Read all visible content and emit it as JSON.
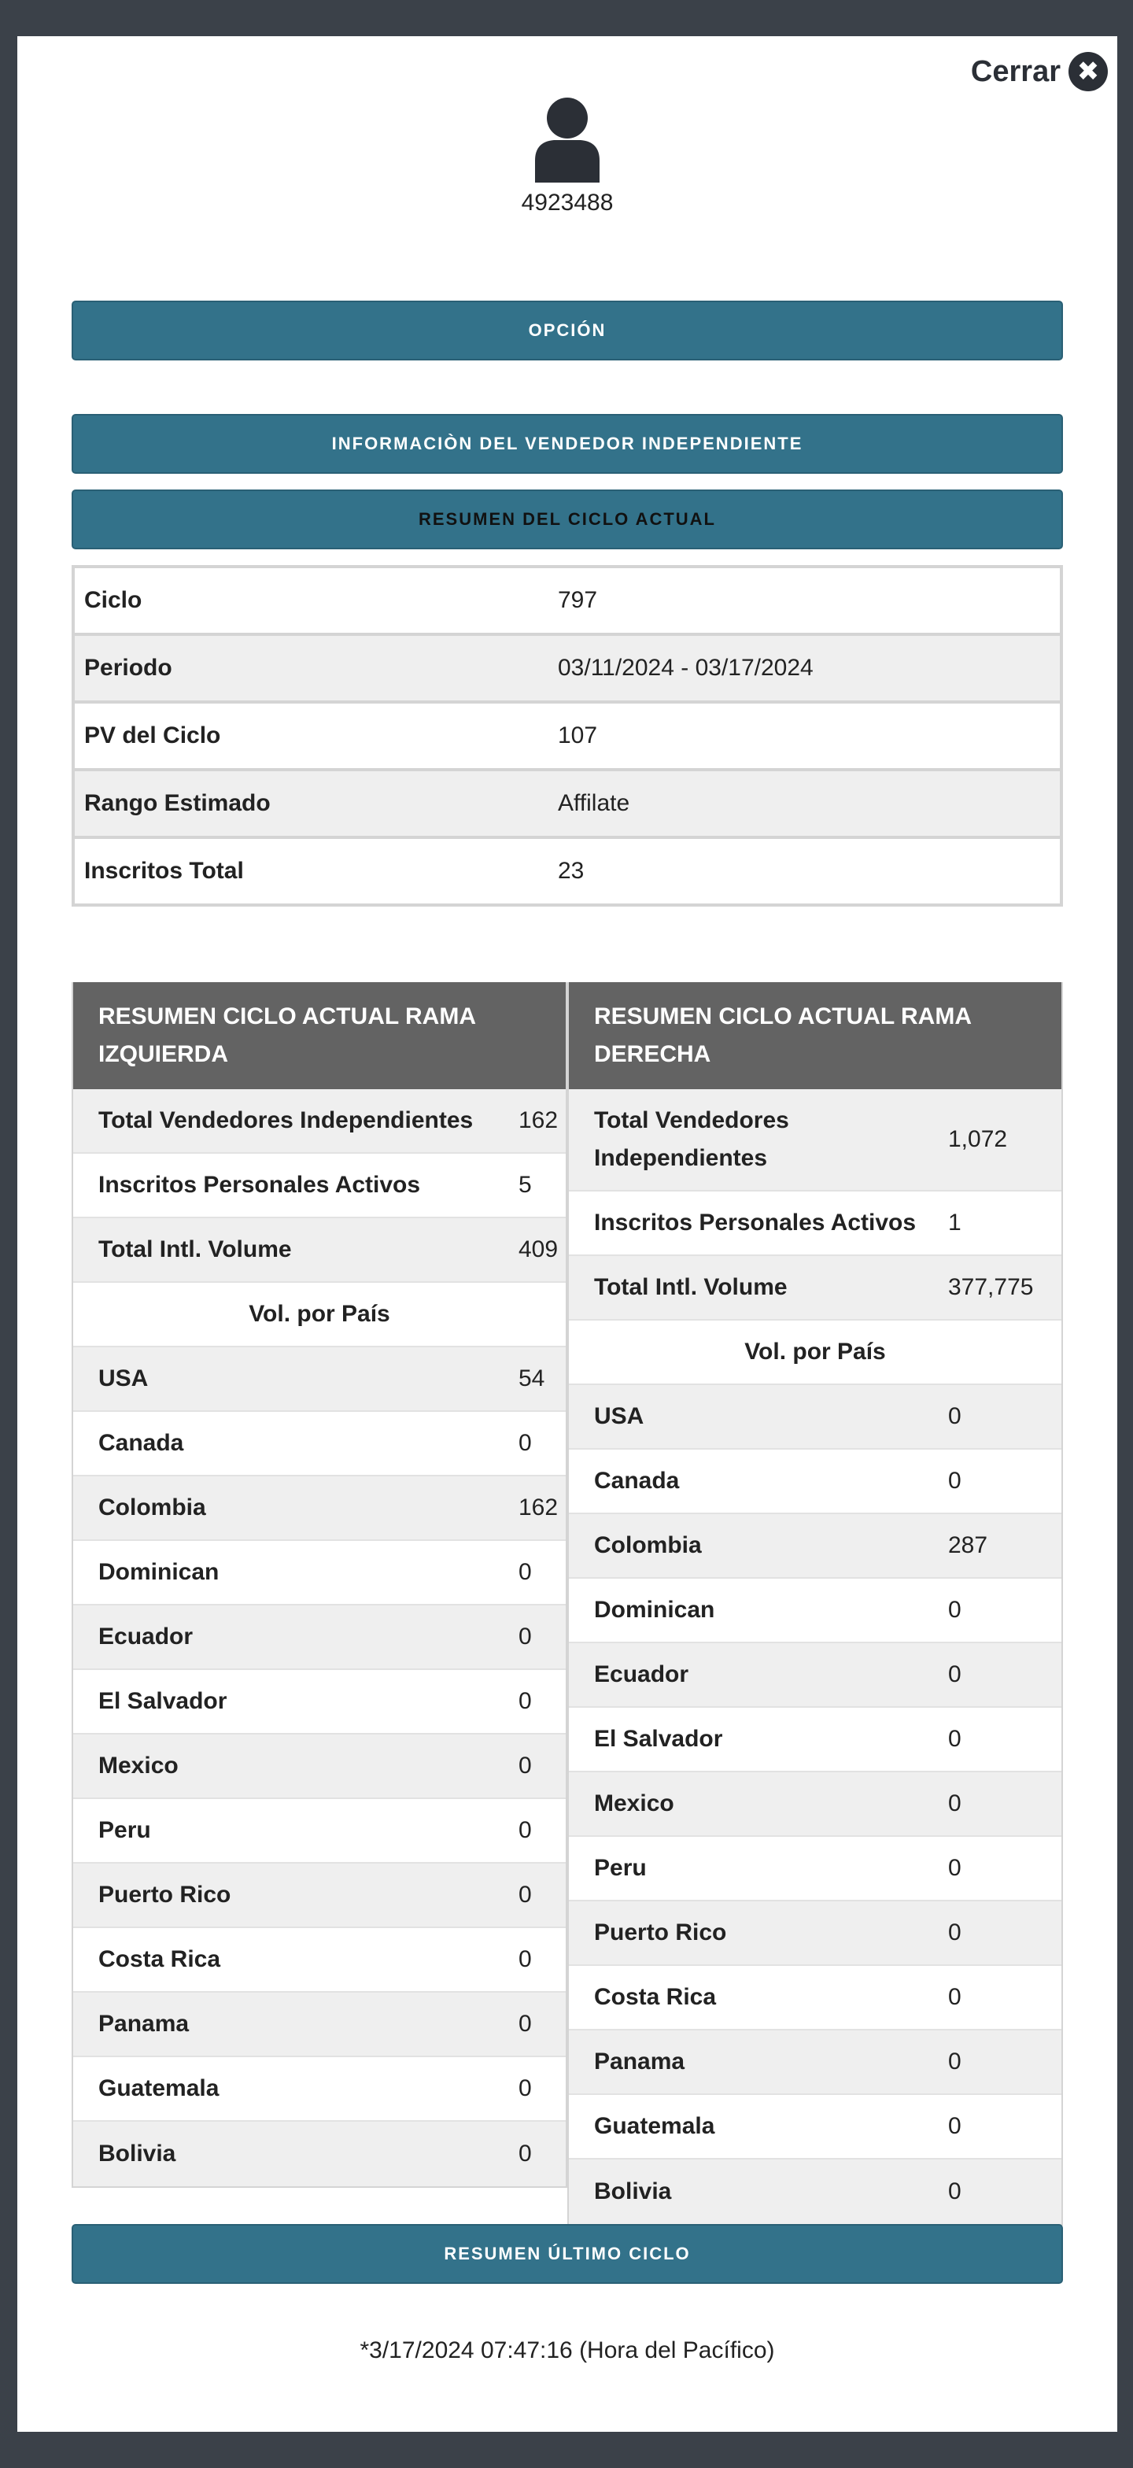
{
  "modal": {
    "close_label": "Cerrar",
    "close_icon": "x-circle-icon",
    "user_id": "4923488"
  },
  "buttons": {
    "option": "OPCIÓN",
    "vendor_info": "INFORMACIÒN DEL VENDEDOR INDEPENDIENTE",
    "current_cycle": "RESUMEN DEL CICLO ACTUAL",
    "last_cycle": "RESUMEN ÚLTIMO CICLO"
  },
  "summary": [
    {
      "label": "Ciclo",
      "value": "797"
    },
    {
      "label": "Periodo",
      "value": "03/11/2024 - 03/17/2024"
    },
    {
      "label": "PV del Ciclo",
      "value": "107"
    },
    {
      "label": "Rango Estimado",
      "value": "Affilate"
    },
    {
      "label": "Inscritos Total",
      "value": "23"
    }
  ],
  "left_branch": {
    "title": "RESUMEN CICLO ACTUAL RAMA IZQUIERDA",
    "stats": [
      {
        "label": "Total Vendedores Independientes",
        "value": "162"
      },
      {
        "label": "Inscritos Personales Activos",
        "value": "5"
      },
      {
        "label": "Total Intl. Volume",
        "value": "409"
      }
    ],
    "country_header": "Vol. por País",
    "countries": [
      {
        "label": "USA",
        "value": "54"
      },
      {
        "label": "Canada",
        "value": "0"
      },
      {
        "label": "Colombia",
        "value": "162"
      },
      {
        "label": "Dominican",
        "value": "0"
      },
      {
        "label": "Ecuador",
        "value": "0"
      },
      {
        "label": "El Salvador",
        "value": "0"
      },
      {
        "label": "Mexico",
        "value": "0"
      },
      {
        "label": "Peru",
        "value": "0"
      },
      {
        "label": "Puerto Rico",
        "value": "0"
      },
      {
        "label": "Costa Rica",
        "value": "0"
      },
      {
        "label": "Panama",
        "value": "0"
      },
      {
        "label": "Guatemala",
        "value": "0"
      },
      {
        "label": "Bolivia",
        "value": "0"
      }
    ]
  },
  "right_branch": {
    "title": "RESUMEN CICLO ACTUAL RAMA DERECHA",
    "stats": [
      {
        "label": "Total Vendedores Independientes",
        "value": "1,072"
      },
      {
        "label": "Inscritos Personales Activos",
        "value": "1"
      },
      {
        "label": "Total Intl. Volume",
        "value": "377,775"
      }
    ],
    "country_header": "Vol. por País",
    "countries": [
      {
        "label": "USA",
        "value": "0"
      },
      {
        "label": "Canada",
        "value": "0"
      },
      {
        "label": "Colombia",
        "value": "287"
      },
      {
        "label": "Dominican",
        "value": "0"
      },
      {
        "label": "Ecuador",
        "value": "0"
      },
      {
        "label": "El Salvador",
        "value": "0"
      },
      {
        "label": "Mexico",
        "value": "0"
      },
      {
        "label": "Peru",
        "value": "0"
      },
      {
        "label": "Puerto Rico",
        "value": "0"
      },
      {
        "label": "Costa Rica",
        "value": "0"
      },
      {
        "label": "Panama",
        "value": "0"
      },
      {
        "label": "Guatemala",
        "value": "0"
      },
      {
        "label": "Bolivia",
        "value": "0"
      }
    ]
  },
  "footer": {
    "timestamp": "*3/17/2024 07:47:16 (Hora del Pacífico)"
  }
}
